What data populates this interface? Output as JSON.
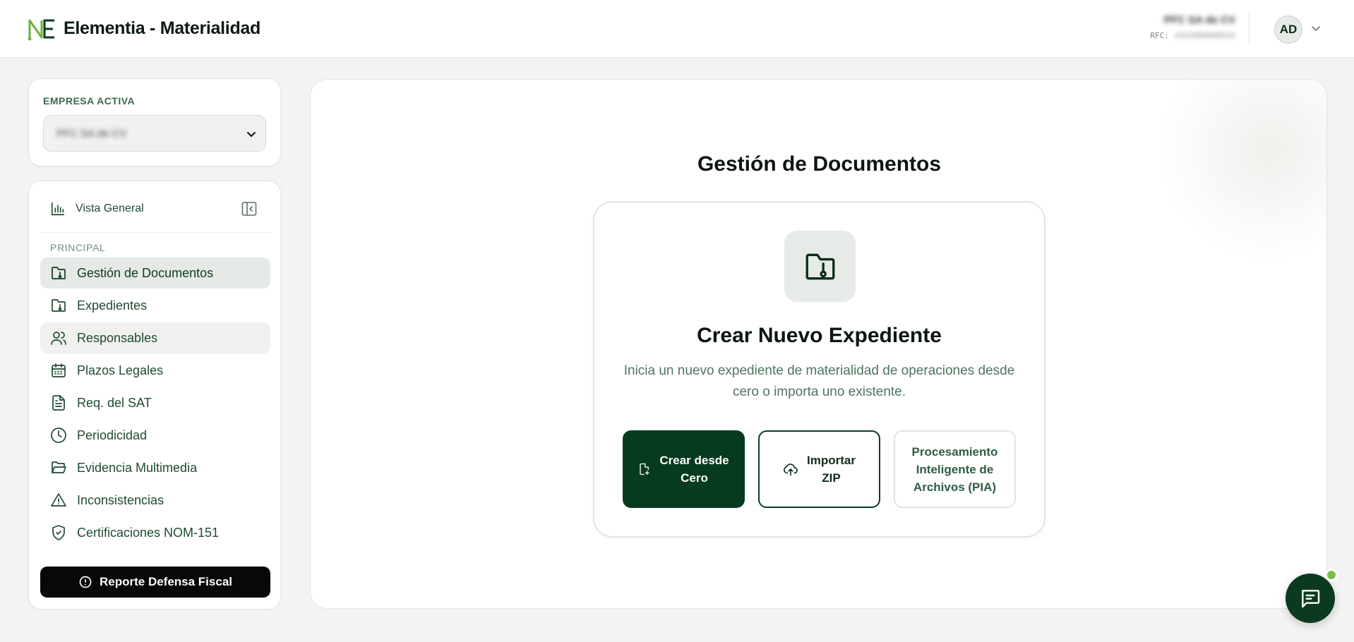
{
  "header": {
    "app_title": "Elementia - Materialidad",
    "company_name": "PFC SA de CV",
    "rfc_label": "RFC:",
    "rfc_value": "XXXX000000XXX",
    "avatar_initials": "AD"
  },
  "company_selector": {
    "label": "EMPRESA ACTIVA",
    "selected": "PFC SA de CV"
  },
  "sidebar": {
    "overview_label": "Vista General",
    "section_label": "PRINCIPAL",
    "items": [
      {
        "label": "Gestión de Documentos",
        "icon": "folder-doc-icon",
        "state": "active"
      },
      {
        "label": "Expedientes",
        "icon": "folder-doc-icon",
        "state": "default"
      },
      {
        "label": "Responsables",
        "icon": "users-icon",
        "state": "hover"
      },
      {
        "label": "Plazos Legales",
        "icon": "calendar-icon",
        "state": "default"
      },
      {
        "label": "Req. del SAT",
        "icon": "document-icon",
        "state": "default"
      },
      {
        "label": "Periodicidad",
        "icon": "clock-icon",
        "state": "default"
      },
      {
        "label": "Evidencia Multimedia",
        "icon": "folder-open-icon",
        "state": "default"
      },
      {
        "label": "Inconsistencias",
        "icon": "warning-icon",
        "state": "default"
      },
      {
        "label": "Certificaciones NOM-151",
        "icon": "shield-check-icon",
        "state": "default"
      }
    ],
    "report_button": "Reporte Defensa Fiscal"
  },
  "main": {
    "title": "Gestión de Documentos",
    "card_title": "Crear Nuevo Expediente",
    "card_description": "Inicia un nuevo expediente de materialidad de operaciones desde cero o importa uno existente.",
    "buttons": {
      "create": "Crear desde Cero",
      "import": "Importar ZIP",
      "pia": "Procesamiento Inteligente de Archivos (PIA)"
    }
  },
  "colors": {
    "primary": "#073b1f",
    "accent_green": "#79c04a",
    "text_green": "#1f4a33",
    "background": "#f3f3f1"
  }
}
